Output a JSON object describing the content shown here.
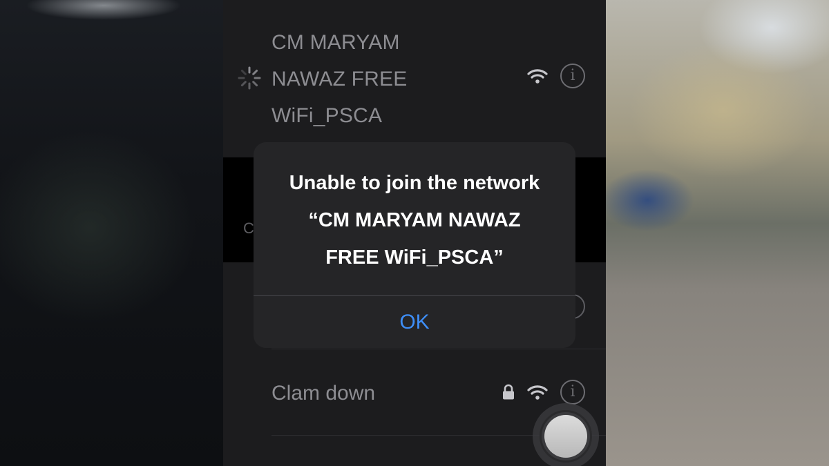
{
  "networks": {
    "current": {
      "name_lines": [
        "CM MARYAM",
        "NAWAZ FREE",
        "WiFi_PSCA"
      ],
      "status": "connecting",
      "secured": false,
      "icons": [
        "spinner-icon",
        "wifi-icon",
        "info-icon"
      ]
    },
    "partially_hidden_letter": "C",
    "clam": {
      "name": "Clam down",
      "secured": true,
      "icons": [
        "lock-icon",
        "wifi-icon",
        "info-icon"
      ]
    }
  },
  "alert": {
    "title_lines": [
      "Unable to join the network",
      "“CM MARYAM NAWAZ",
      "FREE WiFi_PSCA”"
    ],
    "ok_label": "OK",
    "ok_color": "#3e8ef7"
  },
  "icons": {
    "info_glyph": "i"
  },
  "colors": {
    "background": "#1c1c1e",
    "alert_background": "#252527",
    "text_primary": "#ffffff",
    "text_secondary": "#8d8d92"
  }
}
